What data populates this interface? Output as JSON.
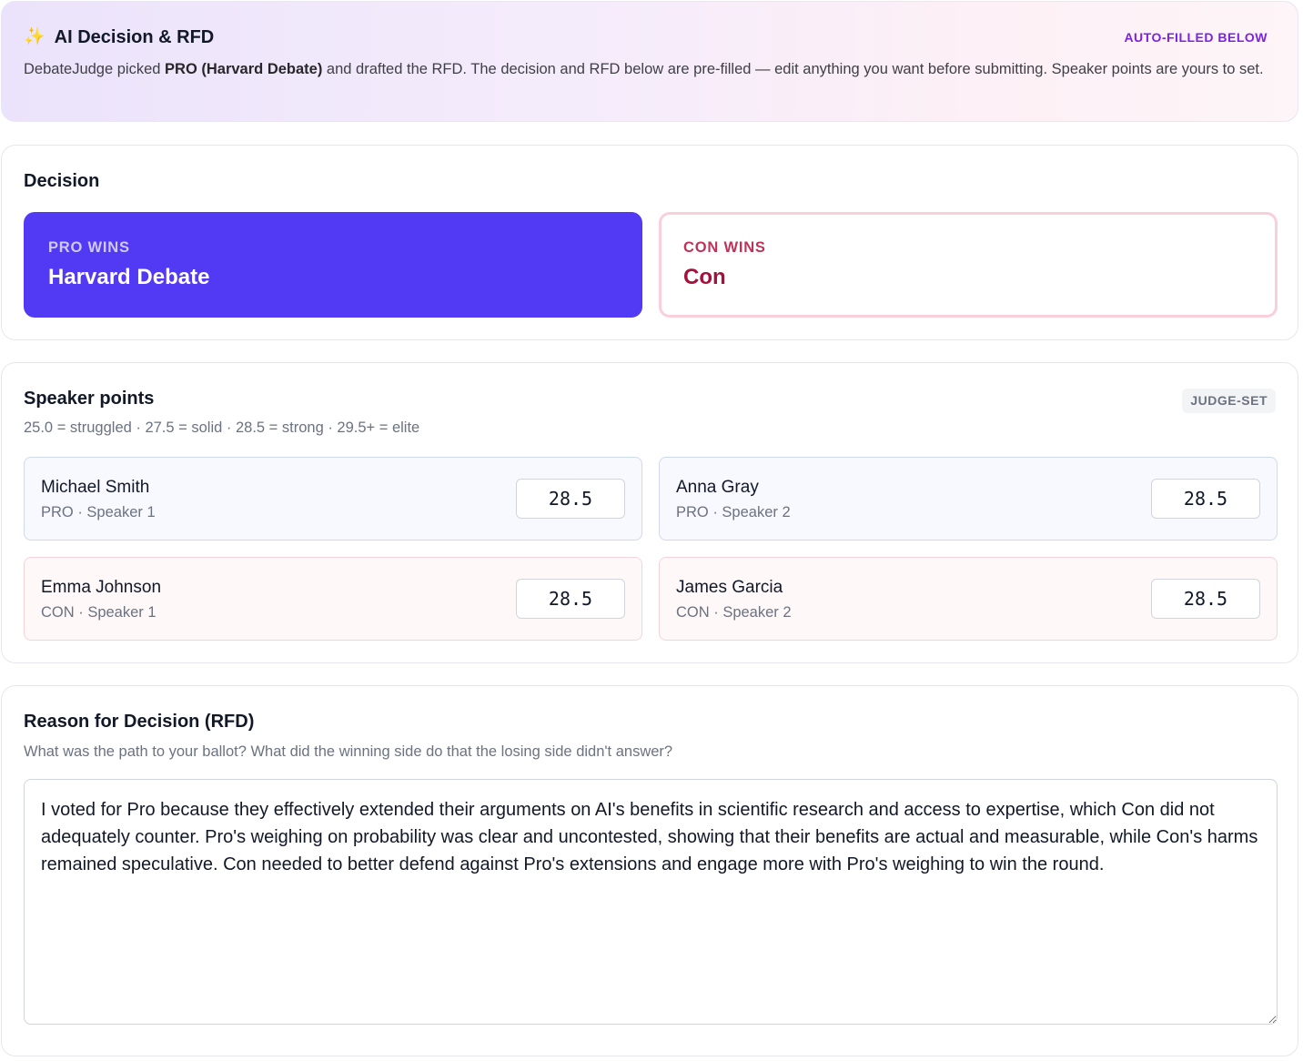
{
  "banner": {
    "icon": "sparkles-icon",
    "title": "AI Decision & RFD",
    "tag": "AUTO-FILLED BELOW",
    "desc_prefix": "DebateJudge picked ",
    "desc_bold": "PRO (Harvard Debate)",
    "desc_suffix": " and drafted the RFD. The decision and RFD below are pre-filled — edit anything you want before submitting. Speaker points are yours to set."
  },
  "decision": {
    "title": "Decision",
    "pro": {
      "side_label": "PRO WINS",
      "team": "Harvard Debate",
      "selected": true
    },
    "con": {
      "side_label": "CON WINS",
      "team": "Con",
      "selected": false
    }
  },
  "speakers": {
    "title": "Speaker points",
    "badge": "JUDGE-SET",
    "scale": "25.0 = struggled · 27.5 = solid · 28.5 = strong · 29.5+ = elite",
    "items": [
      {
        "name": "Michael Smith",
        "role": "PRO · Speaker 1",
        "points": "28.5"
      },
      {
        "name": "Anna Gray",
        "role": "PRO · Speaker 2",
        "points": "28.5"
      },
      {
        "name": "Emma Johnson",
        "role": "CON · Speaker 1",
        "points": "28.5"
      },
      {
        "name": "James Garcia",
        "role": "CON · Speaker 2",
        "points": "28.5"
      }
    ]
  },
  "rfd": {
    "title": "Reason for Decision (RFD)",
    "hint": "What was the path to your ballot? What did the winning side do that the losing side didn't answer?",
    "text": "I voted for Pro because they effectively extended their arguments on AI's benefits in scientific research and access to expertise, which Con did not adequately counter. Pro's weighing on probability was clear and uncontested, showing that their benefits are actual and measurable, while Con's harms remained speculative. Con needed to better defend against Pro's extensions and engage more with Pro's weighing to win the round."
  },
  "colors": {
    "accent": "#523af5",
    "con_accent": "#a3123d",
    "tag": "#7c22e0"
  }
}
